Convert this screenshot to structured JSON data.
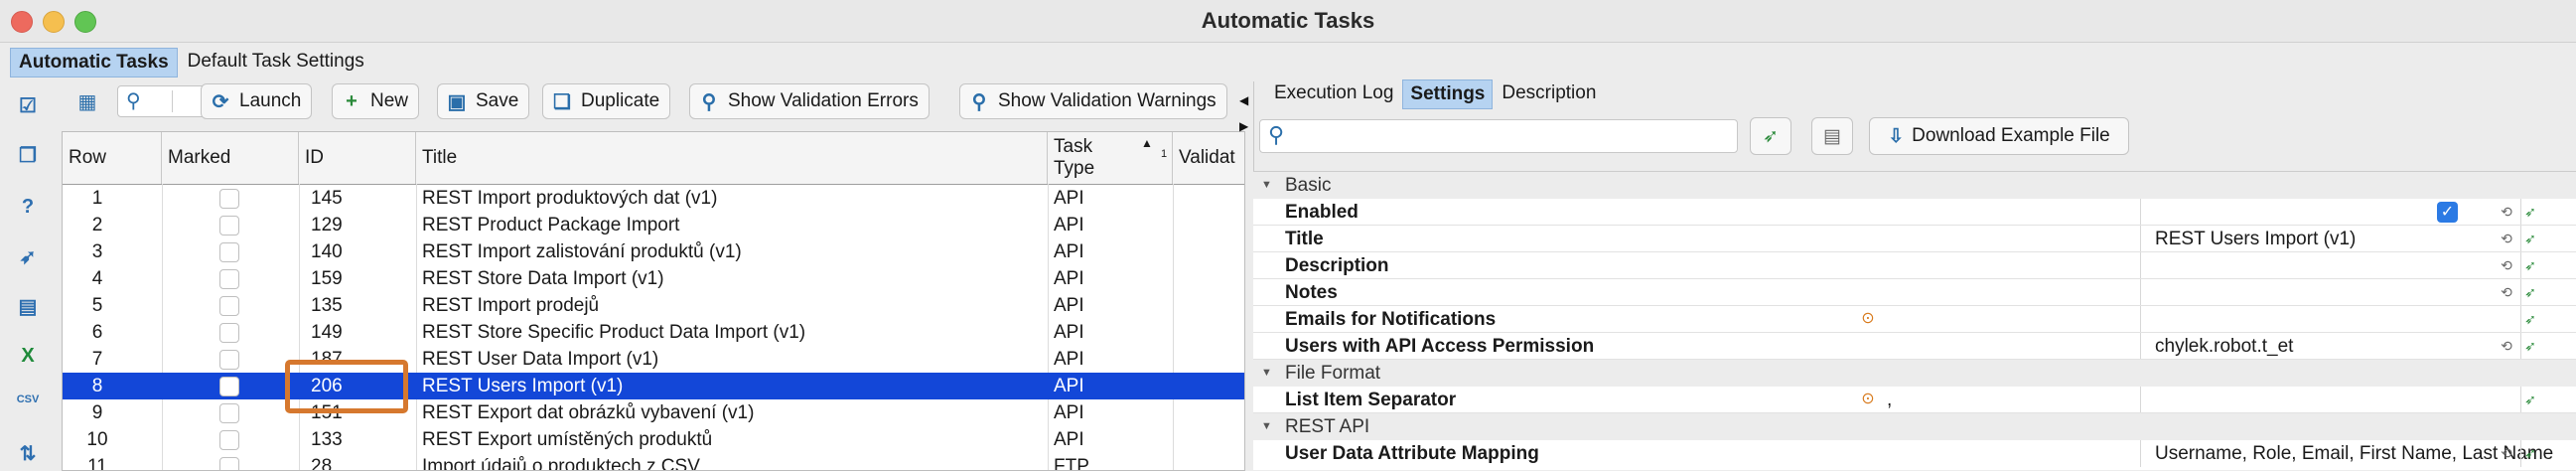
{
  "window": {
    "title": "Automatic Tasks"
  },
  "main_tabs": [
    "Automatic Tasks",
    "Default Task Settings"
  ],
  "toolbar": {
    "launch": "Launch",
    "new": "New",
    "save": "Save",
    "duplicate": "Duplicate",
    "show_validation_errors": "Show Validation Errors",
    "show_validation_warnings": "Show Validation Warnings"
  },
  "table": {
    "headers": {
      "row": "Row",
      "marked": "Marked",
      "id": "ID",
      "title": "Title",
      "task_type_1": "Task",
      "task_type_2": "Type",
      "sort_index": "1",
      "validation": "Validat"
    },
    "rows": [
      {
        "row": "1",
        "id": "145",
        "title": "REST Import produktových dat (v1)",
        "type": "API"
      },
      {
        "row": "2",
        "id": "129",
        "title": "REST Product Package Import",
        "type": "API"
      },
      {
        "row": "3",
        "id": "140",
        "title": "REST Import zalistování produktů (v1)",
        "type": "API"
      },
      {
        "row": "4",
        "id": "159",
        "title": "REST Store Data Import (v1)",
        "type": "API"
      },
      {
        "row": "5",
        "id": "135",
        "title": "REST Import prodejů",
        "type": "API"
      },
      {
        "row": "6",
        "id": "149",
        "title": "REST Store Specific Product Data Import (v1)",
        "type": "API"
      },
      {
        "row": "7",
        "id": "187",
        "title": "REST User Data Import (v1)",
        "type": "API"
      },
      {
        "row": "8",
        "id": "206",
        "title": "REST Users Import (v1)",
        "type": "API"
      },
      {
        "row": "9",
        "id": "151",
        "title": "REST Export dat obrázků vybavení (v1)",
        "type": "API"
      },
      {
        "row": "10",
        "id": "133",
        "title": "REST Export umístěných produktů",
        "type": "API"
      },
      {
        "row": "11",
        "id": "28",
        "title": "Import údajů o produktech z CSV",
        "type": "FTP"
      }
    ]
  },
  "right_tabs": [
    "Execution Log",
    "Settings",
    "Description"
  ],
  "right_toolbar": {
    "download_example": "Download Example File"
  },
  "properties": {
    "group_basic": "Basic",
    "enabled": "Enabled",
    "enabled_value": true,
    "title": "Title",
    "title_value": "REST Users Import (v1)",
    "description": "Description",
    "notes": "Notes",
    "emails": "Emails for Notifications",
    "users_api": "Users with API Access Permission",
    "users_api_value": "chylek.robot.t_et",
    "group_file_format": "File Format",
    "list_separator": "List Item Separator",
    "list_separator_value": ",",
    "group_rest_api": "REST API",
    "user_mapping": "User Data Attribute Mapping",
    "user_mapping_value": "Username, Role, Email, First Name, Last Name"
  },
  "colors": {
    "selection": "#1347d8",
    "highlight": "#d6782e",
    "tab_active": "#b6d3f1"
  }
}
